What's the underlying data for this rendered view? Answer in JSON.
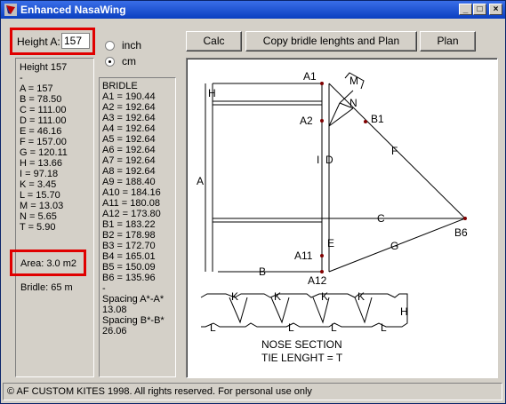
{
  "window": {
    "title": "Enhanced NasaWing"
  },
  "height_input": {
    "label": "Height A:",
    "value": "157"
  },
  "units": {
    "inch": "inch",
    "cm": "cm"
  },
  "toolbar": {
    "calc": "Calc",
    "copy": "Copy bridle lenghts and Plan",
    "plan": "Plan"
  },
  "dims": [
    "Height 157",
    "-",
    "A = 157",
    "B = 78.50",
    "C = 111.00",
    "D = 111.00",
    "E = 46.16",
    "F = 157.00",
    "G = 120.11",
    "H = 13.66",
    "I = 97.18",
    "K = 3.45",
    "L = 15.70",
    "M = 13.03",
    "N = 5.65",
    "T = 5.90"
  ],
  "area": "Area: 3.0 m2",
  "bridle_total": "Bridle: 65 m",
  "bridle_list": [
    "BRIDLE",
    "A1 = 190.44",
    "A2 = 192.64",
    "A3 = 192.64",
    "A4 = 192.64",
    "A5 = 192.64",
    "A6 = 192.64",
    "A7 = 192.64",
    "A8 = 192.64",
    "A9 = 188.40",
    "A10 = 184.16",
    "A11 = 180.08",
    "A12 = 173.80",
    "B1 = 183.22",
    "B2 = 178.98",
    "B3 = 172.70",
    "B4 = 165.01",
    "B5 = 150.09",
    "B6 = 135.96",
    "-",
    "Spacing A*-A*",
    "13.08",
    "Spacing B*-B*",
    "26.06"
  ],
  "diagram": {
    "labels": {
      "A1": "A1",
      "A2": "A2",
      "B1": "B1",
      "B6": "B6",
      "A11": "A11",
      "A12": "A12",
      "A": "A",
      "B": "B",
      "C": "C",
      "D": "D",
      "E": "E",
      "F": "F",
      "G": "G",
      "H": "H",
      "I": "I",
      "M": "M",
      "N": "N",
      "K": "K",
      "L": "L"
    },
    "nose_title": "NOSE SECTION",
    "tie_text": "TIE LENGHT = T"
  },
  "status": "© AF CUSTOM KITES 1998. All rights reserved. For personal use only"
}
